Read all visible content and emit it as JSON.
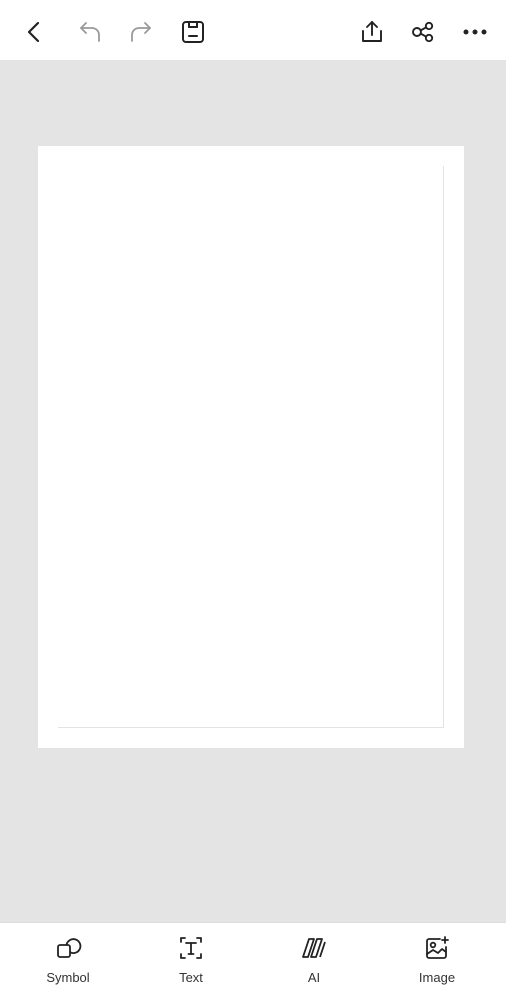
{
  "toolbar": {
    "back_icon": "chevron-left-icon",
    "undo_icon": "undo-icon",
    "redo_icon": "redo-icon",
    "save_icon": "save-icon",
    "share_icon": "share-upload-icon",
    "collaborate_icon": "node-link-icon",
    "more_icon": "more-horizontal-icon",
    "icon_color": "#222222",
    "disabled_color": "#9a9a9a"
  },
  "canvas": {
    "background": "#e4e4e4",
    "page_color": "#ffffff"
  },
  "bottom_tools": [
    {
      "label": "Symbol",
      "icon": "shapes-icon"
    },
    {
      "label": "Text",
      "icon": "text-box-icon"
    },
    {
      "label": "AI",
      "icon": "ai-icon"
    },
    {
      "label": "Image",
      "icon": "image-add-icon"
    }
  ]
}
